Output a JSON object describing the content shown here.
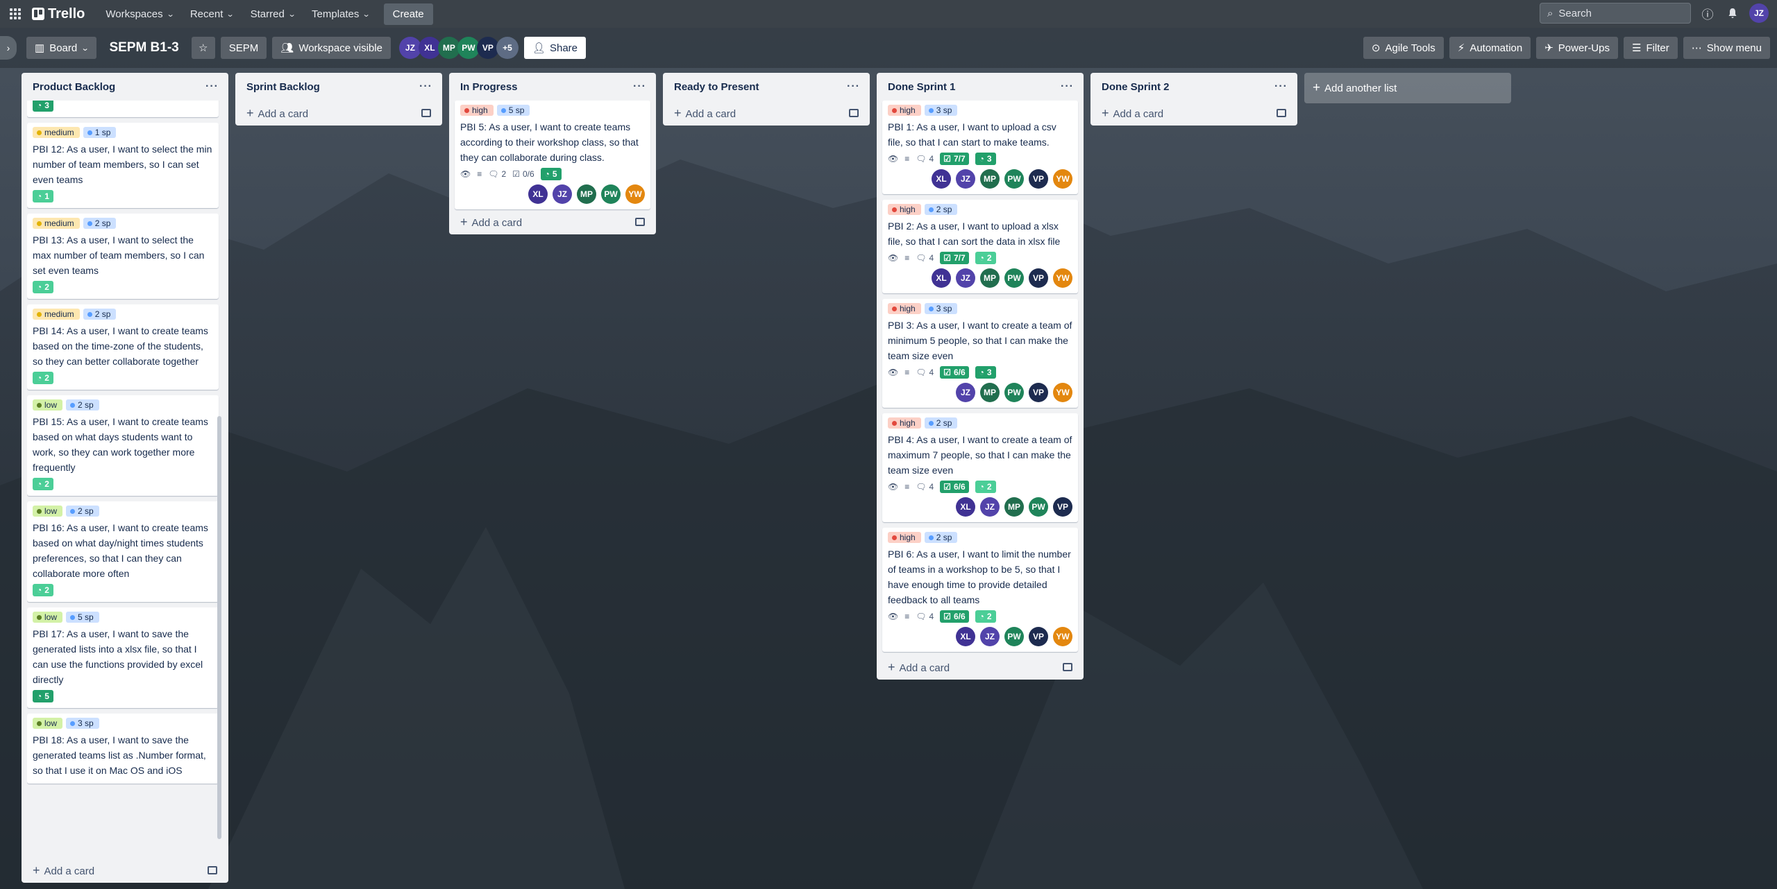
{
  "nav": {
    "logo": "Trello",
    "workspaces": "Workspaces",
    "recent": "Recent",
    "starred": "Starred",
    "templates": "Templates",
    "create": "Create",
    "search_placeholder": "Search",
    "me": "JZ"
  },
  "board": {
    "view": "Board",
    "title": "SEPM B1-3",
    "workspace": "SEPM",
    "visibility": "Workspace visible",
    "members": [
      "JZ",
      "XL",
      "MP",
      "PW",
      "VP"
    ],
    "more_members": "+5",
    "share": "Share",
    "agile_tools": "Agile Tools",
    "automation": "Automation",
    "powerups": "Power-Ups",
    "filter": "Filter",
    "show_menu": "Show menu",
    "add_list": "Add another list",
    "add_card": "Add a card"
  },
  "lists": {
    "product_backlog": {
      "title": "Product Backlog",
      "top_points": "3",
      "cards": [
        {
          "priority": "medium",
          "sp": "1 sp",
          "title": "PBI 12: As a user, I want to select the min number of team members, so I can set even teams",
          "points": "1"
        },
        {
          "priority": "medium",
          "sp": "2 sp",
          "title": "PBI 13: As a user, I want to select the max number of team members, so I can set even teams",
          "points": "2"
        },
        {
          "priority": "medium",
          "sp": "2 sp",
          "title": "PBI 14: As a user, I want to create teams based on the time-zone of the students, so they can better collaborate together",
          "points": "2"
        },
        {
          "priority": "low",
          "sp": "2 sp",
          "title": "PBI 15: As a user, I want to create teams based on what days students want to work, so they can work together more frequently",
          "points": "2"
        },
        {
          "priority": "low",
          "sp": "2 sp",
          "title": "PBI 16: As a user, I want to create teams based on what day/night times students preferences, so that I can they can collaborate more often",
          "points": "2"
        },
        {
          "priority": "low",
          "sp": "5 sp",
          "title": "PBI 17: As a user, I want to save the generated lists into a xlsx file, so that I can use the functions provided by excel directly",
          "points": "5"
        },
        {
          "priority": "low",
          "sp": "3 sp",
          "title": "PBI 18: As a user, I want to save the generated teams list as .Number format, so that I use it on Mac OS and iOS",
          "points": ""
        }
      ]
    },
    "sprint_backlog": {
      "title": "Sprint Backlog"
    },
    "in_progress": {
      "title": "In Progress",
      "card": {
        "priority": "high",
        "sp": "5 sp",
        "title": "PBI 5: As a user, I want to create teams according to their workshop class, so that they can collaborate during class.",
        "comments": "2",
        "checklist": "0/6",
        "points": "5",
        "members": [
          "XL",
          "JZ",
          "MP",
          "PW",
          "YW"
        ]
      }
    },
    "ready_to_present": {
      "title": "Ready to Present"
    },
    "done_sprint_1": {
      "title": "Done Sprint 1",
      "cards": [
        {
          "priority": "high",
          "sp": "3 sp",
          "title": "PBI 1: As a user, I want to upload a csv file, so that I can start to make teams.",
          "comments": "4",
          "checklist": "7/7",
          "points": "3",
          "members": [
            "XL",
            "JZ",
            "MP",
            "PW",
            "VP",
            "YW"
          ]
        },
        {
          "priority": "high",
          "sp": "2 sp",
          "title": "PBI 2: As a user, I want to upload a xlsx file, so that I can sort the data in xlsx file",
          "comments": "4",
          "checklist": "7/7",
          "points": "2",
          "members": [
            "XL",
            "JZ",
            "MP",
            "PW",
            "VP",
            "YW"
          ]
        },
        {
          "priority": "high",
          "sp": "3 sp",
          "title": "PBI 3: As a user, I want to create a team of minimum 5 people, so that I can make the team size even",
          "comments": "4",
          "checklist": "6/6",
          "points": "3",
          "members": [
            "JZ",
            "MP",
            "PW",
            "VP",
            "YW"
          ]
        },
        {
          "priority": "high",
          "sp": "2 sp",
          "title": "PBI 4: As a user, I want to create a team of maximum 7 people, so that I can make the team size even",
          "comments": "4",
          "checklist": "6/6",
          "points": "2",
          "members": [
            "XL",
            "JZ",
            "MP",
            "PW",
            "VP"
          ]
        },
        {
          "priority": "high",
          "sp": "2 sp",
          "title": "PBI 6: As a user, I want to limit the number of teams in a workshop to be 5, so that I have enough time to provide detailed feedback to all teams",
          "comments": "4",
          "checklist": "6/6",
          "points": "2",
          "members": [
            "XL",
            "JZ",
            "PW",
            "VP",
            "YW"
          ]
        }
      ]
    },
    "done_sprint_2": {
      "title": "Done Sprint 2"
    }
  }
}
